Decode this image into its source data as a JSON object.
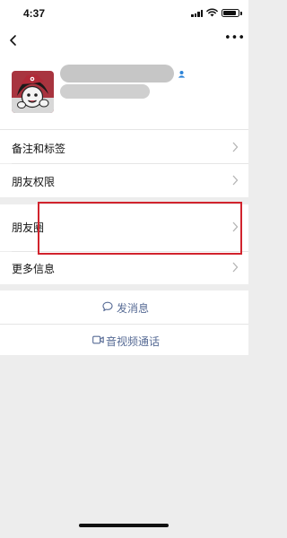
{
  "status_bar": {
    "time": "4:37",
    "battery_level": 0.85
  },
  "nav": {
    "back_icon": "chevron-left-icon",
    "more_icon": "more-dots-icon",
    "more_text": "•••"
  },
  "profile": {
    "avatar": "avatar-image",
    "name_redacted": true,
    "contact_icon": "contact-person-icon"
  },
  "menu": {
    "items": [
      {
        "label": "备注和标签"
      },
      {
        "label": "朋友权限"
      },
      {
        "label": "朋友圈"
      },
      {
        "label": "更多信息"
      }
    ]
  },
  "actions": {
    "message": {
      "label": "发消息",
      "icon": "message-bubble-icon"
    },
    "call": {
      "label": "音视频通话",
      "icon": "video-camera-icon"
    }
  },
  "colors": {
    "link_blue": "#576b95",
    "highlight_red": "#d1232d",
    "background": "#ededed"
  }
}
